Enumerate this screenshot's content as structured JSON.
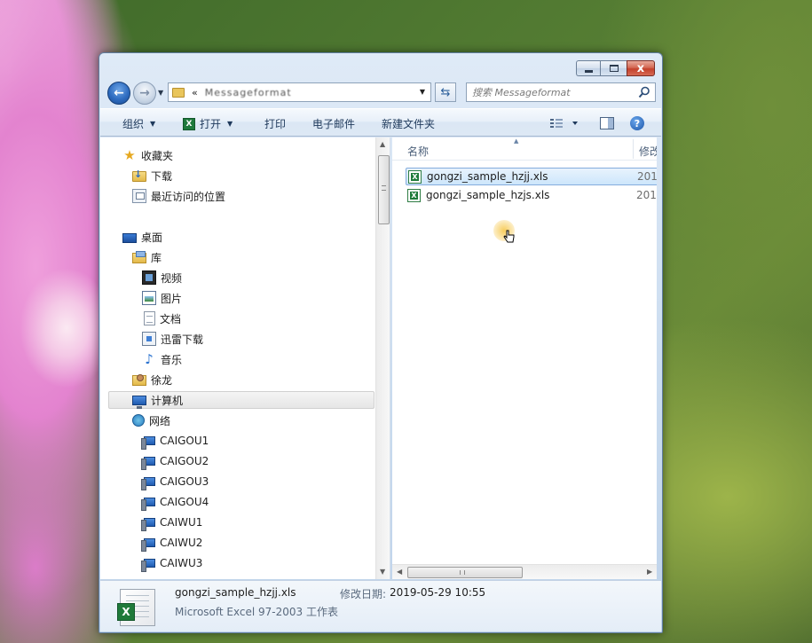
{
  "window": {
    "address_path": "Messageformat",
    "search_placeholder": "搜索 Messageformat",
    "caption": {
      "minimize": "",
      "maximize": "",
      "close": "x"
    }
  },
  "toolbar": {
    "organize": "组织",
    "open": "打开",
    "print": "打印",
    "email": "电子邮件",
    "new_folder": "新建文件夹"
  },
  "navpane": {
    "favorites": "收藏夹",
    "downloads": "下载",
    "recent": "最近访问的位置",
    "desktop": "桌面",
    "libraries": "库",
    "videos": "视频",
    "pictures": "图片",
    "documents": "文档",
    "xunlei": "迅雷下载",
    "music": "音乐",
    "user": "徐龙",
    "computer": "计算机",
    "network": "网络",
    "hosts": [
      "CAIGOU1",
      "CAIGOU2",
      "CAIGOU3",
      "CAIGOU4",
      "CAIWU1",
      "CAIWU2",
      "CAIWU3"
    ]
  },
  "filelist": {
    "col_name": "名称",
    "col_modified": "修改",
    "files": [
      {
        "name": "gongzi_sample_hzjj.xls",
        "date": "201",
        "selected": true
      },
      {
        "name": "gongzi_sample_hzjs.xls",
        "date": "201",
        "selected": false
      }
    ]
  },
  "details": {
    "name": "gongzi_sample_hzjj.xls",
    "modified_label": "修改日期:",
    "modified_value": "2019-05-29 10:55",
    "type": "Microsoft Excel 97-2003 工作表"
  },
  "colors": {
    "accent": "#3399ff",
    "selection": "#cde6fb",
    "excel_green": "#1f7a3a"
  }
}
